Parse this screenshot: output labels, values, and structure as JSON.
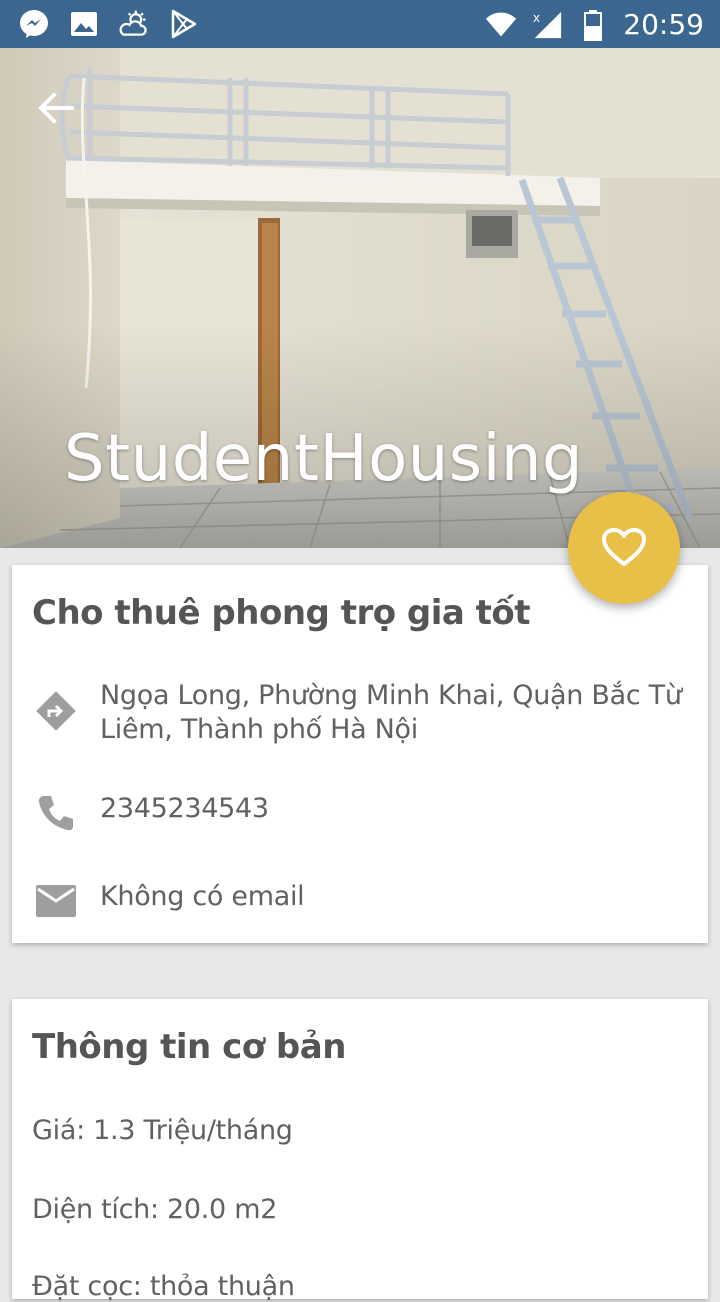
{
  "status_bar": {
    "time": "20:59",
    "left_icons": [
      "messenger-icon",
      "gallery-icon",
      "weather-icon",
      "play-store-icon"
    ],
    "right_icons": [
      "wifi-icon",
      "signal-icon",
      "battery-icon"
    ]
  },
  "hero": {
    "title": "StudentHousing"
  },
  "listing": {
    "title": "Cho thuê phong trọ gia tốt",
    "address": "Ngọa Long, Phường Minh Khai, Quận Bắc Từ Liêm, Thành phố Hà Nội",
    "phone": "2345234543",
    "email": "Không có email"
  },
  "basic_info": {
    "title": "Thông tin cơ bản",
    "price": "Giá: 1.3 Triệu/tháng",
    "area": "Diện tích: 20.0 m2",
    "partial": "Đặt cọc: thỏa thuận"
  },
  "colors": {
    "status_bar": "#3b6690",
    "fab": "#e8bf47",
    "background": "#e8e8e8"
  }
}
